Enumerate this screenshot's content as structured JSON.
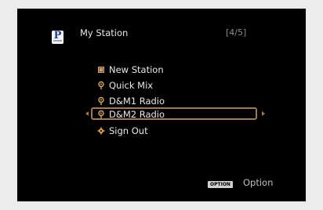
{
  "header": {
    "title": "My Station",
    "page_indicator": "[4/5]",
    "logo_letter": "P",
    "logo_icon": "pandora-logo-icon"
  },
  "menu": {
    "items": [
      {
        "label": "New Station",
        "icon": "folder-icon",
        "selected": false
      },
      {
        "label": "Quick Mix",
        "icon": "radio-mic-icon",
        "selected": false
      },
      {
        "label": "D&M1 Radio",
        "icon": "radio-mic-icon",
        "selected": false
      },
      {
        "label": "D&M2 Radio",
        "icon": "radio-mic-icon",
        "selected": true
      },
      {
        "label": "Sign Out",
        "icon": "gear-icon",
        "selected": false
      }
    ]
  },
  "footer": {
    "option_badge": "OPTION",
    "option_label": "Option"
  },
  "colors": {
    "background": "#000000",
    "text": "#e8e8e8",
    "selection_frame": "#a07a4c",
    "folder_icon": "#c8a070",
    "mic_icon": "#d8a858",
    "gear_icon": "#e0a040",
    "dim_text": "#8a8a8a"
  }
}
